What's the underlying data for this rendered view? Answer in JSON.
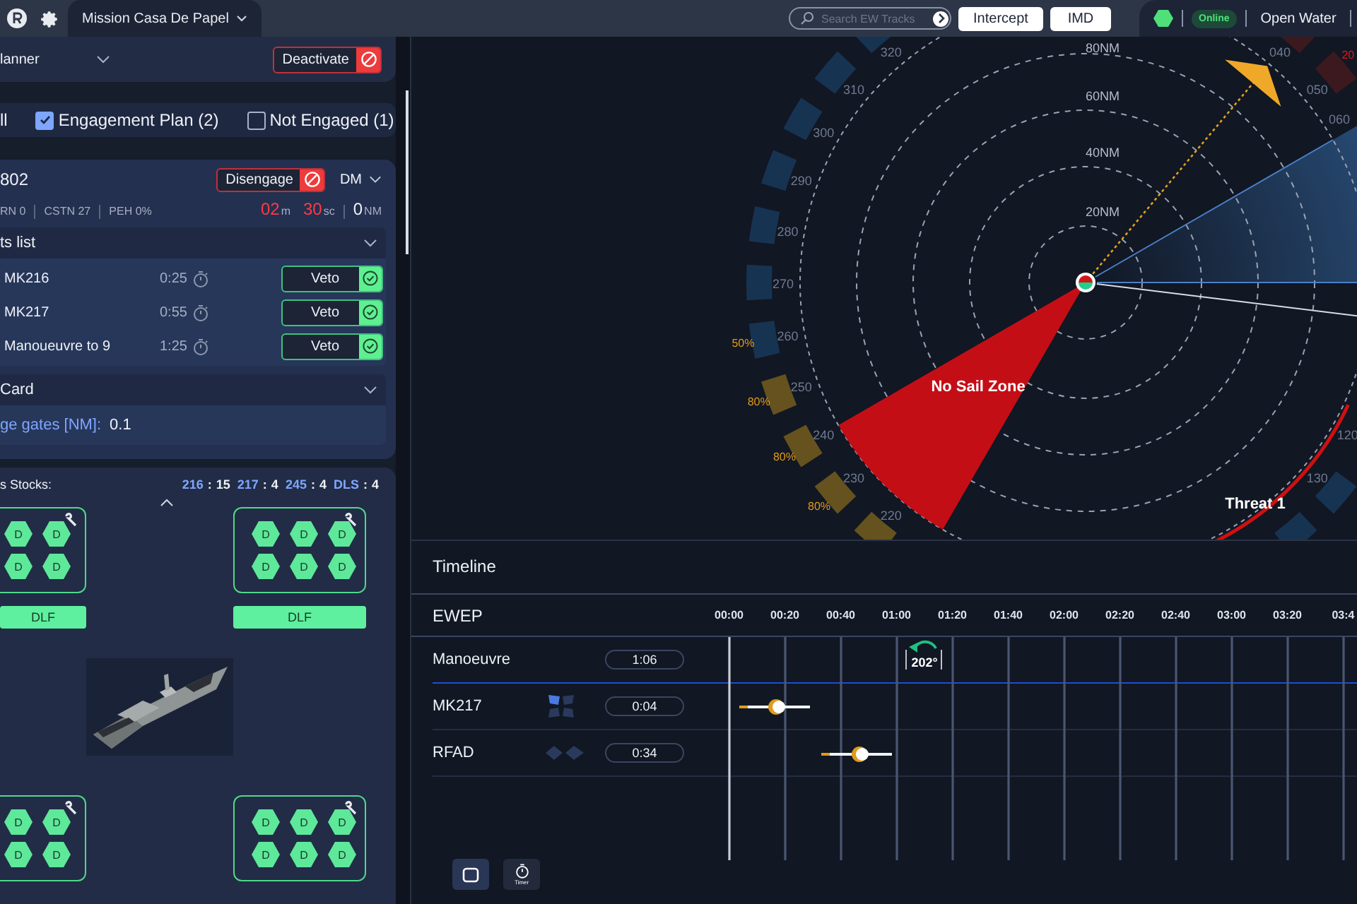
{
  "top_bar": {
    "mission_tab": "Mission Casa De Papel",
    "search": {
      "placeholder": "Search EW Tracks"
    },
    "buttons": [
      "Intercept",
      "IMD"
    ],
    "status": "Online",
    "mode": "Open Water"
  },
  "planner": {
    "title": "lanner",
    "action": "Deactivate"
  },
  "filters": [
    {
      "label": "ll",
      "kind": "text"
    },
    {
      "label": "Engagement Plan (2)",
      "kind": "checkbox",
      "checked": true
    },
    {
      "label": "Not Engaged (1)",
      "kind": "checkbox",
      "checked": false
    }
  ],
  "track": {
    "title": "802",
    "action": "Disengage",
    "mode": "DM",
    "stats": [
      "RN 0",
      "CSTN 27",
      "PEH 0%"
    ],
    "countdown": [
      {
        "value": "02",
        "unit": "m",
        "kind": "alert"
      },
      {
        "value": "30",
        "unit": "sc",
        "kind": "alert"
      },
      {
        "value": "0",
        "unit": "NM",
        "kind": "normal"
      }
    ]
  },
  "events": {
    "title": "ts list",
    "rows": [
      {
        "name": "MK216",
        "time": "0:25",
        "action": "Veto"
      },
      {
        "name": "MK217",
        "time": "0:55",
        "action": "Veto"
      },
      {
        "name": "Manoueuvre to 9",
        "time": "1:25",
        "action": "Veto"
      }
    ]
  },
  "card": {
    "title": "Card",
    "field": {
      "label": "ge gates [NM]:",
      "value": "0.1"
    }
  },
  "stocks": {
    "title": "s Stocks:",
    "counts": [
      {
        "label": "216",
        "sep": ":",
        "value": "15"
      },
      {
        "label": "217",
        "sep": ":",
        "value": "4"
      },
      {
        "label": "245",
        "sep": ":",
        "value": "4"
      },
      {
        "label": "DLS",
        "sep": ":",
        "value": "4"
      }
    ],
    "launchers": [
      {
        "cells": [
          "D",
          "D",
          "D",
          "D"
        ],
        "tube": "DLF"
      },
      {
        "cells": [
          "D",
          "D",
          "D",
          "D",
          "D",
          "D"
        ],
        "tube": "DLF"
      },
      {
        "cells": [
          "D",
          "D",
          "D",
          "D"
        ]
      },
      {
        "cells": [
          "D",
          "D",
          "D",
          "D",
          "D",
          "D"
        ]
      }
    ]
  },
  "radar": {
    "ranges": [
      "80NM",
      "60NM",
      "40NM",
      "20NM"
    ],
    "bearings": [
      "320",
      "310",
      "300",
      "290",
      "280",
      "270",
      "260",
      "250",
      "240",
      "230",
      "220",
      "040",
      "050",
      "060",
      "120",
      "130"
    ],
    "levels": [
      {
        "label": "50%",
        "color": "#e09a1c"
      },
      {
        "label": "80%",
        "color": "#e09a1c"
      },
      {
        "label": "80%",
        "color": "#e09a1c"
      },
      {
        "label": "80%",
        "color": "#e09a1c"
      },
      {
        "label": "20",
        "color": "#e01818"
      }
    ],
    "zone": "No Sail Zone",
    "threat": "Threat 1"
  },
  "timeline": {
    "title": "Timeline",
    "section": "EWEP",
    "ticks": [
      "00:00",
      "00:20",
      "00:40",
      "01:00",
      "01:20",
      "01:40",
      "02:00",
      "02:20",
      "02:40",
      "03:00",
      "03:20",
      "03:4"
    ],
    "rows": [
      {
        "name": "Manoeuvre",
        "duration": "1:06",
        "kind": "manoeuvre",
        "marker": "202°"
      },
      {
        "name": "MK217",
        "duration": "0:04",
        "kind": "weapon"
      },
      {
        "name": "RFAD",
        "duration": "0:34",
        "kind": "decoy"
      }
    ],
    "tools": [
      {
        "kind": "square"
      },
      {
        "kind": "timer",
        "label": "Timer"
      }
    ]
  }
}
